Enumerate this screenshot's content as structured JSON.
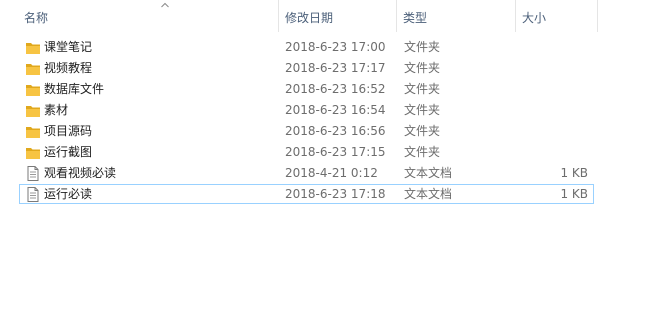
{
  "columns": {
    "name": "名称",
    "date": "修改日期",
    "type": "类型",
    "size": "大小"
  },
  "sort": {
    "column": "name",
    "direction": "ascending"
  },
  "files": [
    {
      "name": "课堂笔记",
      "date": "2018-6-23 17:00",
      "type": "文件夹",
      "size": "",
      "icon": "folder-icon"
    },
    {
      "name": "视频教程",
      "date": "2018-6-23 17:17",
      "type": "文件夹",
      "size": "",
      "icon": "folder-icon"
    },
    {
      "name": "数据库文件",
      "date": "2018-6-23 16:52",
      "type": "文件夹",
      "size": "",
      "icon": "folder-icon"
    },
    {
      "name": "素材",
      "date": "2018-6-23 16:54",
      "type": "文件夹",
      "size": "",
      "icon": "folder-icon"
    },
    {
      "name": "项目源码",
      "date": "2018-6-23 16:56",
      "type": "文件夹",
      "size": "",
      "icon": "folder-icon"
    },
    {
      "name": "运行截图",
      "date": "2018-6-23 17:15",
      "type": "文件夹",
      "size": "",
      "icon": "folder-icon"
    },
    {
      "name": "观看视频必读",
      "date": "2018-4-21 0:12",
      "type": "文本文档",
      "size": "1 KB",
      "icon": "text-document-icon"
    },
    {
      "name": "运行必读",
      "date": "2018-6-23 17:18",
      "type": "文本文档",
      "size": "1 KB",
      "icon": "text-document-icon",
      "selected": true
    }
  ],
  "colors": {
    "folder": "#f7c443",
    "folder_dark": "#e0a81d",
    "selection_border": "#99d1ff",
    "header_text": "#4c607a",
    "meta_text": "#6d6d6d"
  }
}
